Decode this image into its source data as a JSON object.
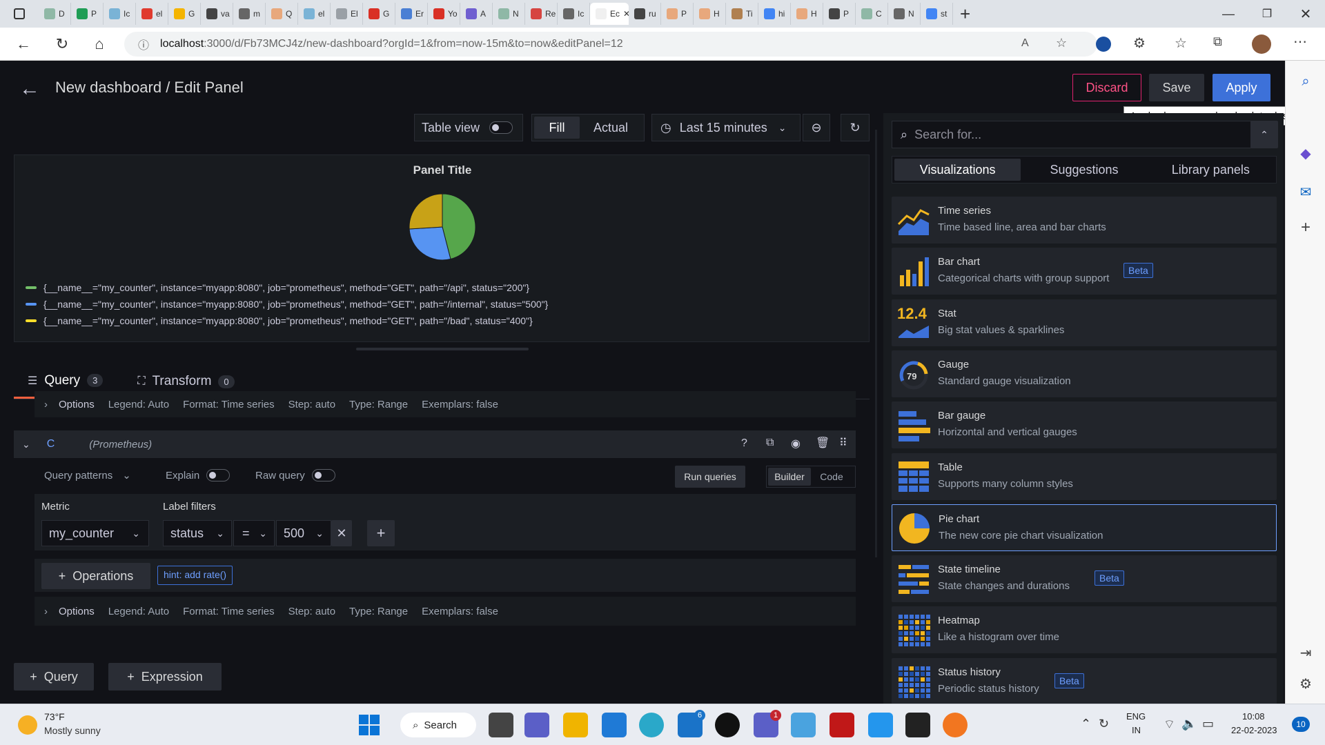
{
  "browser": {
    "tabs": [
      {
        "label": "D",
        "color": "#8fb8a6"
      },
      {
        "label": "P",
        "color": "#1f9d55"
      },
      {
        "label": "Ic",
        "color": "#7ab3d6"
      },
      {
        "label": "el",
        "color": "#e03b2f"
      },
      {
        "label": "G",
        "color": "#f4b400"
      },
      {
        "label": "va",
        "color": "#444444"
      },
      {
        "label": "m",
        "color": "#666666"
      },
      {
        "label": "Q",
        "color": "#e8a87c"
      },
      {
        "label": "el",
        "color": "#7ab3d6"
      },
      {
        "label": "El",
        "color": "#9aa0a6"
      },
      {
        "label": "G",
        "color": "#d93025"
      },
      {
        "label": "Er",
        "color": "#4a7fd4"
      },
      {
        "label": "Yo",
        "color": "#d93025"
      },
      {
        "label": "A",
        "color": "#6f5fd0"
      },
      {
        "label": "N",
        "color": "#8fb8a6"
      },
      {
        "label": "Re",
        "color": "#d64541"
      },
      {
        "label": "Ic",
        "color": "#666666"
      },
      {
        "label": "Ec",
        "color": "#f0f0f0",
        "active": true
      },
      {
        "label": "ru",
        "color": "#444444"
      },
      {
        "label": "P",
        "color": "#e8a87c"
      },
      {
        "label": "H",
        "color": "#e8a87c"
      },
      {
        "label": "Ti",
        "color": "#b08050"
      },
      {
        "label": "hi",
        "color": "#4285f4"
      },
      {
        "label": "H",
        "color": "#e8a87c"
      },
      {
        "label": "P",
        "color": "#444444"
      },
      {
        "label": "C",
        "color": "#8fb8a6"
      },
      {
        "label": "N",
        "color": "#666666"
      },
      {
        "label": "st",
        "color": "#4285f4"
      }
    ],
    "url_host": "localhost",
    "url_rest": ":3000/d/Fb73MCJ4z/new-dashboard?orgId=1&from=now-15m&to=now&editPanel=12"
  },
  "header": {
    "title": "New dashboard / Edit Panel",
    "discard": "Discard",
    "save": "Save",
    "apply": "Apply",
    "tooltip": "Apply changes and go back to dashboard"
  },
  "toolbar": {
    "table_view": "Table view",
    "fill": "Fill",
    "actual": "Actual",
    "time_range": "Last 15 minutes"
  },
  "panel": {
    "title": "Panel Title",
    "legend": [
      {
        "text": "{__name__=\"my_counter\", instance=\"myapp:8080\", job=\"prometheus\", method=\"GET\", path=\"/api\", status=\"200\"}",
        "color": "#73bf69"
      },
      {
        "text": "{__name__=\"my_counter\", instance=\"myapp:8080\", job=\"prometheus\", method=\"GET\", path=\"/internal\", status=\"500\"}",
        "color": "#5794f2"
      },
      {
        "text": "{__name__=\"my_counter\", instance=\"myapp:8080\", job=\"prometheus\", method=\"GET\", path=\"/bad\", status=\"400\"}",
        "color": "#fade2a"
      }
    ]
  },
  "chart_data": {
    "type": "pie",
    "slices": [
      {
        "value": 0.46,
        "color": "#56a64b"
      },
      {
        "value": 0.28,
        "color": "#5794f2"
      },
      {
        "value": 0.26,
        "color": "#c8a217"
      }
    ]
  },
  "tabs": {
    "query": "Query",
    "query_count": "3",
    "transform": "Transform",
    "transform_count": "0"
  },
  "options_row": {
    "label": "Options",
    "legend": "Legend: Auto",
    "format": "Format: Time series",
    "step": "Step: auto",
    "type": "Type: Range",
    "exemplars": "Exemplars: false"
  },
  "query_c": {
    "ref": "C",
    "datasource": "(Prometheus)",
    "query_patterns": "Query patterns",
    "explain": "Explain",
    "raw_query": "Raw query",
    "run_queries": "Run queries",
    "builder": "Builder",
    "code": "Code",
    "metric_label": "Metric",
    "metric_value": "my_counter",
    "label_filters": "Label filters",
    "filter_label": "status",
    "filter_op": "=",
    "filter_value": "500",
    "operations": "Operations",
    "hint": "hint: add rate()"
  },
  "add": {
    "query": "Query",
    "expression": "Expression"
  },
  "right": {
    "search_placeholder": "Search for...",
    "tabs": [
      "Visualizations",
      "Suggestions",
      "Library panels"
    ],
    "viz": [
      {
        "title": "Time series",
        "desc": "Time based line, area and bar charts",
        "icon": "time-series-icon"
      },
      {
        "title": "Bar chart",
        "desc": "Categorical charts with group support",
        "icon": "bar-chart-icon",
        "beta": true
      },
      {
        "title": "Stat",
        "desc": "Big stat values & sparklines",
        "icon": "stat-icon"
      },
      {
        "title": "Gauge",
        "desc": "Standard gauge visualization",
        "icon": "gauge-icon"
      },
      {
        "title": "Bar gauge",
        "desc": "Horizontal and vertical gauges",
        "icon": "bar-gauge-icon"
      },
      {
        "title": "Table",
        "desc": "Supports many column styles",
        "icon": "table-icon"
      },
      {
        "title": "Pie chart",
        "desc": "The new core pie chart visualization",
        "icon": "pie-chart-icon",
        "selected": true
      },
      {
        "title": "State timeline",
        "desc": "State changes and durations",
        "icon": "state-timeline-icon",
        "beta": true
      },
      {
        "title": "Heatmap",
        "desc": "Like a histogram over time",
        "icon": "heatmap-icon"
      },
      {
        "title": "Status history",
        "desc": "Periodic status history",
        "icon": "status-history-icon",
        "beta": true
      }
    ],
    "beta_label": "Beta",
    "stat_value": "12.4",
    "gauge_value": "79"
  },
  "taskbar": {
    "temp": "73°F",
    "weather": "Mostly sunny",
    "search": "Search",
    "lang1": "ENG",
    "lang2": "IN",
    "time": "10:08",
    "date": "22-02-2023",
    "notif": "10",
    "mail_badge": "6",
    "teams_badge": "1"
  }
}
